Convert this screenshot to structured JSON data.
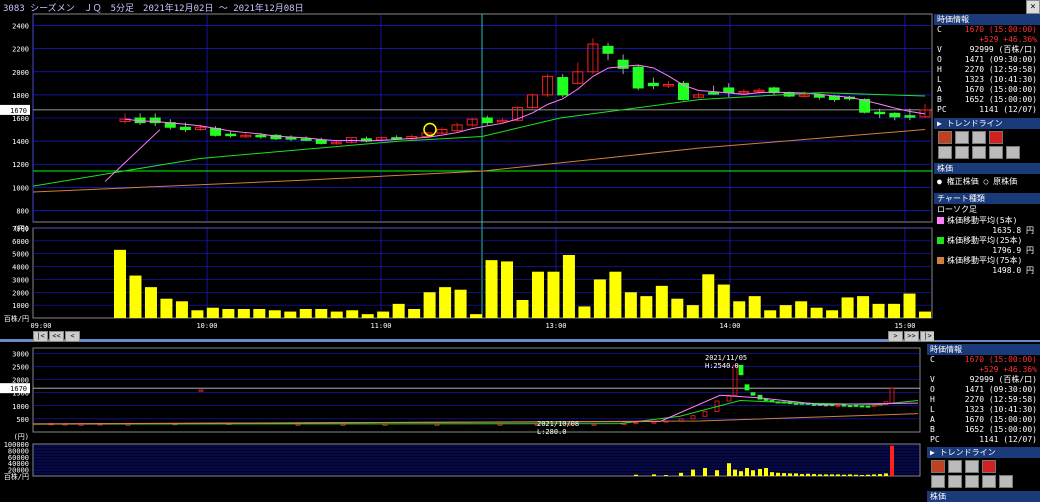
{
  "title": "3083 シーズメン　ＪＱ　5分足　2021年12月02日 ～ 2021年12月08日",
  "close_label": "×",
  "colors": {
    "grid": "#2020ff",
    "up": "#ff2020",
    "down": "#20ff20",
    "volume": "#ffff00",
    "ma5": "#ff80ff",
    "ma25": "#20e020",
    "ma75": "#d08040",
    "price_line": "#c8c8c8",
    "support": "#00ff00"
  },
  "price_label": "1670",
  "top_chart": {
    "y_ticks": [
      "2400",
      "2200",
      "2000",
      "1800",
      "1600",
      "1400",
      "1200",
      "1000",
      "800",
      "(円)"
    ],
    "vol_ticks": [
      "7000",
      "6000",
      "5000",
      "4000",
      "3000",
      "2000",
      "1000",
      "百株/円"
    ],
    "time_ticks": [
      "09:00",
      "10:00",
      "11:00",
      "12:00",
      "13:00",
      "14:00",
      "15:00"
    ]
  },
  "bottom_chart": {
    "y_ticks": [
      "3000",
      "2500",
      "2000",
      "1500",
      "1000",
      "500",
      "(円)"
    ],
    "vol_ticks": [
      "100000",
      "80000",
      "60000",
      "40000",
      "20000",
      "百株/円"
    ],
    "annot_high": {
      "date": "2021/11/05",
      "value": "H:2540.0"
    },
    "annot_low": {
      "date": "2021/10/08",
      "value": "L:280.0"
    }
  },
  "candles": [
    {
      "o": 1570,
      "h": 1640,
      "c": 1590,
      "l": 1550
    },
    {
      "o": 1600,
      "h": 1640,
      "c": 1560,
      "l": 1540
    },
    {
      "o": 1600,
      "h": 1640,
      "c": 1560,
      "l": 1530
    },
    {
      "o": 1560,
      "h": 1590,
      "c": 1520,
      "l": 1500
    },
    {
      "o": 1520,
      "h": 1560,
      "c": 1500,
      "l": 1480
    },
    {
      "o": 1500,
      "h": 1540,
      "c": 1520,
      "l": 1490
    },
    {
      "o": 1510,
      "h": 1530,
      "c": 1450,
      "l": 1440
    },
    {
      "o": 1460,
      "h": 1490,
      "c": 1450,
      "l": 1430
    },
    {
      "o": 1450,
      "h": 1480,
      "c": 1450,
      "l": 1430
    },
    {
      "o": 1450,
      "h": 1470,
      "c": 1440,
      "l": 1420
    },
    {
      "o": 1450,
      "h": 1460,
      "c": 1420,
      "l": 1410
    },
    {
      "o": 1430,
      "h": 1450,
      "c": 1420,
      "l": 1400
    },
    {
      "o": 1420,
      "h": 1440,
      "c": 1410,
      "l": 1400
    },
    {
      "o": 1410,
      "h": 1430,
      "c": 1380,
      "l": 1370
    },
    {
      "o": 1380,
      "h": 1410,
      "c": 1390,
      "l": 1370
    },
    {
      "o": 1390,
      "h": 1420,
      "c": 1430,
      "l": 1380
    },
    {
      "o": 1420,
      "h": 1440,
      "c": 1400,
      "l": 1390
    },
    {
      "o": 1410,
      "h": 1440,
      "c": 1430,
      "l": 1400
    },
    {
      "o": 1430,
      "h": 1450,
      "c": 1420,
      "l": 1410
    },
    {
      "o": 1420,
      "h": 1460,
      "c": 1440,
      "l": 1410
    },
    {
      "o": 1440,
      "h": 1480,
      "c": 1470,
      "l": 1430
    },
    {
      "o": 1470,
      "h": 1520,
      "c": 1500,
      "l": 1460
    },
    {
      "o": 1490,
      "h": 1560,
      "c": 1540,
      "l": 1480
    },
    {
      "o": 1540,
      "h": 1600,
      "c": 1590,
      "l": 1520
    },
    {
      "o": 1600,
      "h": 1620,
      "c": 1560,
      "l": 1540
    },
    {
      "o": 1580,
      "h": 1600,
      "c": 1580,
      "l": 1570
    },
    {
      "o": 1580,
      "h": 1700,
      "c": 1690,
      "l": 1570
    },
    {
      "o": 1690,
      "h": 1810,
      "c": 1800,
      "l": 1680
    },
    {
      "o": 1800,
      "h": 1980,
      "c": 1960,
      "l": 1780
    },
    {
      "o": 1950,
      "h": 1980,
      "c": 1800,
      "l": 1780
    },
    {
      "o": 1900,
      "h": 2080,
      "c": 2000,
      "l": 1890
    },
    {
      "o": 2000,
      "h": 2290,
      "c": 2240,
      "l": 1980
    },
    {
      "o": 2220,
      "h": 2250,
      "c": 2160,
      "l": 2100
    },
    {
      "o": 2100,
      "h": 2150,
      "c": 2030,
      "l": 1980
    },
    {
      "o": 2040,
      "h": 2060,
      "c": 1860,
      "l": 1840
    },
    {
      "o": 1900,
      "h": 1950,
      "c": 1880,
      "l": 1850
    },
    {
      "o": 1880,
      "h": 1920,
      "c": 1890,
      "l": 1860
    },
    {
      "o": 1900,
      "h": 1920,
      "c": 1760,
      "l": 1750
    },
    {
      "o": 1780,
      "h": 1820,
      "c": 1800,
      "l": 1770
    },
    {
      "o": 1820,
      "h": 1880,
      "c": 1810,
      "l": 1800
    },
    {
      "o": 1860,
      "h": 1900,
      "c": 1820,
      "l": 1780
    },
    {
      "o": 1820,
      "h": 1850,
      "c": 1830,
      "l": 1810
    },
    {
      "o": 1830,
      "h": 1860,
      "c": 1840,
      "l": 1810
    },
    {
      "o": 1860,
      "h": 1870,
      "c": 1820,
      "l": 1800
    },
    {
      "o": 1820,
      "h": 1830,
      "c": 1790,
      "l": 1780
    },
    {
      "o": 1800,
      "h": 1830,
      "c": 1800,
      "l": 1780
    },
    {
      "o": 1800,
      "h": 1810,
      "c": 1780,
      "l": 1760
    },
    {
      "o": 1790,
      "h": 1800,
      "c": 1760,
      "l": 1740
    },
    {
      "o": 1780,
      "h": 1790,
      "c": 1770,
      "l": 1750
    },
    {
      "o": 1760,
      "h": 1770,
      "c": 1650,
      "l": 1640
    },
    {
      "o": 1650,
      "h": 1680,
      "c": 1640,
      "l": 1600
    },
    {
      "o": 1640,
      "h": 1650,
      "c": 1610,
      "l": 1580
    },
    {
      "o": 1620,
      "h": 1680,
      "c": 1610,
      "l": 1580
    },
    {
      "o": 1610,
      "h": 1720,
      "c": 1670,
      "l": 1600
    }
  ],
  "volumes": [
    5300,
    3300,
    2400,
    1500,
    1300,
    600,
    800,
    700,
    700,
    700,
    600,
    500,
    700,
    700,
    500,
    600,
    300,
    500,
    1100,
    700,
    2000,
    2400,
    2200,
    300,
    4500,
    4400,
    1400,
    3600,
    3600,
    4900,
    900,
    3000,
    3600,
    2000,
    1700,
    2500,
    1500,
    1000,
    3400,
    2600,
    1300,
    1700,
    600,
    1000,
    1300,
    800,
    600,
    1600,
    1700,
    1100,
    1100,
    1900,
    500
  ],
  "bottom_candles": [
    {
      "x": 18,
      "o": 320,
      "c": 320
    },
    {
      "x": 32,
      "o": 300,
      "c": 310
    },
    {
      "x": 48,
      "o": 300,
      "c": 300
    },
    {
      "x": 67,
      "o": 310,
      "c": 310
    },
    {
      "x": 95,
      "o": 300,
      "c": 300
    },
    {
      "x": 142,
      "o": 300,
      "c": 320
    },
    {
      "x": 168,
      "o": 1600,
      "c": 1600
    },
    {
      "x": 196,
      "o": 300,
      "c": 330
    },
    {
      "x": 265,
      "o": 300,
      "c": 300
    },
    {
      "x": 310,
      "o": 300,
      "c": 300
    },
    {
      "x": 352,
      "o": 300,
      "c": 300
    },
    {
      "x": 404,
      "o": 300,
      "c": 300
    },
    {
      "x": 467,
      "o": 300,
      "c": 300
    },
    {
      "x": 504,
      "o": 300,
      "c": 300
    },
    {
      "x": 537,
      "o": 300,
      "c": 300
    },
    {
      "x": 561,
      "o": 300,
      "c": 300
    },
    {
      "x": 591,
      "o": 300,
      "c": 330
    },
    {
      "x": 603,
      "o": 330,
      "c": 360
    },
    {
      "x": 621,
      "o": 350,
      "c": 380
    },
    {
      "x": 633,
      "o": 380,
      "c": 420
    },
    {
      "x": 648,
      "o": 420,
      "c": 500
    },
    {
      "x": 660,
      "o": 500,
      "c": 620
    },
    {
      "x": 672,
      "o": 600,
      "c": 780
    },
    {
      "x": 684,
      "o": 780,
      "c": 1180
    },
    {
      "x": 696,
      "o": 1180,
      "c": 1400
    },
    {
      "x": 702,
      "o": 1400,
      "c": 2540
    },
    {
      "x": 708,
      "o": 2540,
      "c": 2180
    },
    {
      "x": 714,
      "o": 1800,
      "c": 1600
    },
    {
      "x": 720,
      "o": 1500,
      "c": 1400
    },
    {
      "x": 727,
      "o": 1400,
      "c": 1250
    },
    {
      "x": 733,
      "o": 1250,
      "c": 1200
    },
    {
      "x": 739,
      "o": 1200,
      "c": 1150
    },
    {
      "x": 745,
      "o": 1150,
      "c": 1120
    },
    {
      "x": 751,
      "o": 1150,
      "c": 1100
    },
    {
      "x": 757,
      "o": 1150,
      "c": 1080
    },
    {
      "x": 763,
      "o": 1100,
      "c": 1050
    },
    {
      "x": 769,
      "o": 1100,
      "c": 1060
    },
    {
      "x": 775,
      "o": 1100,
      "c": 1050
    },
    {
      "x": 781,
      "o": 1060,
      "c": 1040
    },
    {
      "x": 787,
      "o": 1060,
      "c": 1030
    },
    {
      "x": 793,
      "o": 1040,
      "c": 1020
    },
    {
      "x": 799,
      "o": 1050,
      "c": 1000
    },
    {
      "x": 805,
      "o": 1000,
      "c": 1010
    },
    {
      "x": 811,
      "o": 1030,
      "c": 990
    },
    {
      "x": 817,
      "o": 1010,
      "c": 990
    },
    {
      "x": 823,
      "o": 1020,
      "c": 980
    },
    {
      "x": 829,
      "o": 1000,
      "c": 970
    },
    {
      "x": 835,
      "o": 990,
      "c": 980
    },
    {
      "x": 841,
      "o": 1000,
      "c": 1010
    },
    {
      "x": 847,
      "o": 1000,
      "c": 1050
    },
    {
      "x": 853,
      "o": 1050,
      "c": 1150
    },
    {
      "x": 859,
      "o": 1100,
      "c": 1670
    }
  ],
  "bottom_volumes": [
    {
      "x": 603,
      "v": 4000
    },
    {
      "x": 621,
      "v": 5000
    },
    {
      "x": 633,
      "v": 3000
    },
    {
      "x": 648,
      "v": 10000
    },
    {
      "x": 660,
      "v": 20000
    },
    {
      "x": 672,
      "v": 25000
    },
    {
      "x": 684,
      "v": 18000
    },
    {
      "x": 696,
      "v": 40000
    },
    {
      "x": 702,
      "v": 20000
    },
    {
      "x": 708,
      "v": 15000
    },
    {
      "x": 714,
      "v": 25000
    },
    {
      "x": 720,
      "v": 18000
    },
    {
      "x": 727,
      "v": 22000
    },
    {
      "x": 733,
      "v": 25000
    },
    {
      "x": 739,
      "v": 12000
    },
    {
      "x": 745,
      "v": 10000
    },
    {
      "x": 751,
      "v": 9000
    },
    {
      "x": 757,
      "v": 8000
    },
    {
      "x": 763,
      "v": 8000
    },
    {
      "x": 769,
      "v": 6000
    },
    {
      "x": 775,
      "v": 7000
    },
    {
      "x": 781,
      "v": 6000
    },
    {
      "x": 787,
      "v": 5000
    },
    {
      "x": 793,
      "v": 5000
    },
    {
      "x": 799,
      "v": 5000
    },
    {
      "x": 805,
      "v": 5000
    },
    {
      "x": 811,
      "v": 4000
    },
    {
      "x": 817,
      "v": 5000
    },
    {
      "x": 823,
      "v": 4000
    },
    {
      "x": 829,
      "v": 3000
    },
    {
      "x": 835,
      "v": 4000
    },
    {
      "x": 841,
      "v": 5000
    },
    {
      "x": 847,
      "v": 6000
    },
    {
      "x": 853,
      "v": 8000
    },
    {
      "x": 859,
      "v": 95000
    }
  ],
  "info_panel": {
    "header": "時価情報",
    "rows": [
      {
        "k": "C",
        "v": "1670 (15:00:00)",
        "red": true
      },
      {
        "k": "",
        "v": "+529 +46.36%",
        "red": true
      },
      {
        "k": "V",
        "v": "92999 (百株/口)",
        "red": false
      },
      {
        "k": "O",
        "v": "1471 (09:30:00)",
        "red": false
      },
      {
        "k": "H",
        "v": "2270 (12:59:58)",
        "red": false
      },
      {
        "k": "L",
        "v": "1323 (10:41:30)",
        "red": false
      },
      {
        "k": "A",
        "v": "1670 (15:00:00)",
        "red": false
      },
      {
        "k": "B",
        "v": "1652 (15:00:00)",
        "red": false
      },
      {
        "k": "PC",
        "v": "1141 (12/07)",
        "red": false
      }
    ],
    "trendline_header": "トレンドライン",
    "stock_header": "株価",
    "radio1": "権正株価",
    "radio2": "原株価",
    "chart_type_header": "チャート種類",
    "chart_type": "ローソク足",
    "ma": [
      {
        "label": "株価移動平均(5本)",
        "value": "1635.8 円"
      },
      {
        "label": "株価移動平均(25本)",
        "value": "1796.9 円"
      },
      {
        "label": "株価移動平均(75本)",
        "value": "1498.0 円"
      }
    ]
  },
  "info_panel2": {
    "header": "時価情報",
    "trendline_header": "トレンドライン",
    "bottom_header": "株価"
  },
  "scroll_buttons_left": [
    "|<",
    "<<",
    "<"
  ],
  "scroll_buttons_right": [
    ">",
    ">>",
    "|>"
  ],
  "chart_data": {
    "type": "candlestick",
    "title": "3083 シーズメン　ＪＱ　5分足　2021年12月02日 ～ 2021年12月08日",
    "ylim": [
      700,
      2500
    ],
    "volume_ylim": [
      0,
      7000
    ]
  }
}
